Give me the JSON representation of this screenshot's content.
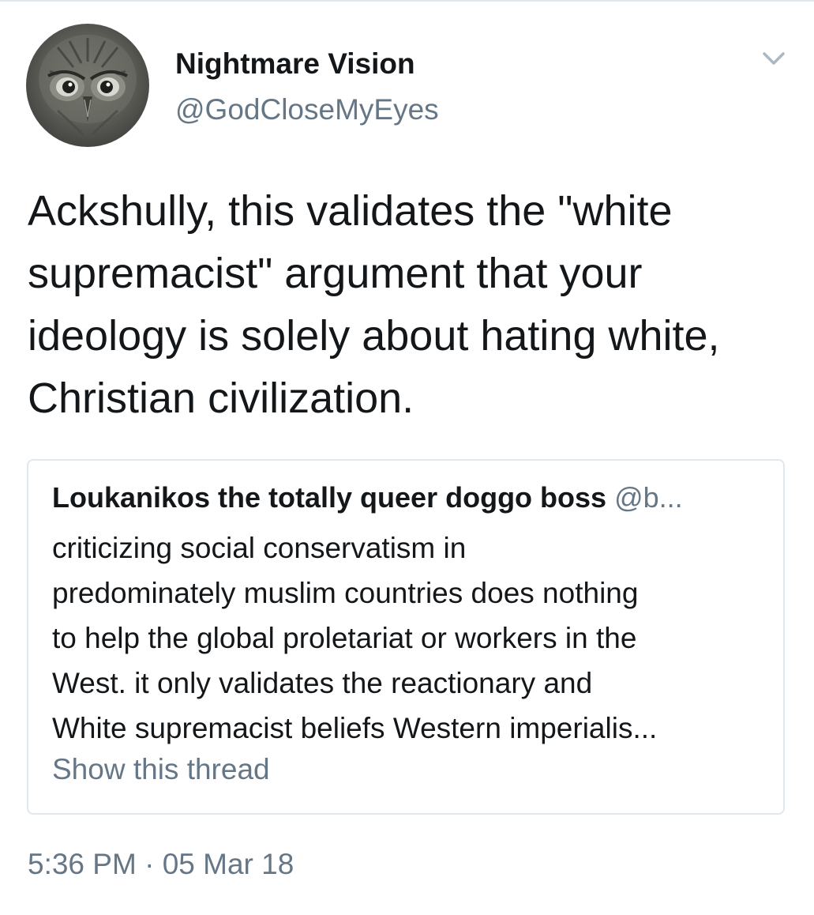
{
  "tweet": {
    "display_name": "Nightmare Vision",
    "handle": "@GodCloseMyEyes",
    "avatar_icon": "owl-avatar",
    "menu_icon": "chevron-down-icon",
    "text": "Ackshully, this validates the \"white supremacist\" argument that your ideology is solely about hating white, Christian civilization.",
    "timestamp": "5:36 PM",
    "separator": "·",
    "date": "05 Mar 18"
  },
  "quoted_tweet": {
    "display_name": "Loukanikos the totally queer doggo boss",
    "handle": "@b...",
    "lines": [
      "criticizing social conservatism in",
      "predominately muslim countries does nothing",
      "to help the global proletariat or workers in the",
      "West. it only validates the reactionary and",
      "White supremacist beliefs Western imperialis..."
    ],
    "show_thread_label": "Show this thread"
  },
  "colors": {
    "text": "#14171a",
    "secondary_text": "#657786",
    "border": "#e1e8ed"
  }
}
